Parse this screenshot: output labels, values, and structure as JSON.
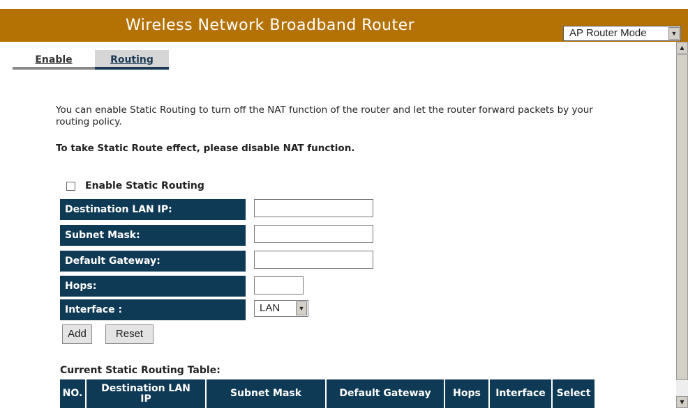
{
  "header": {
    "title": "Wireless Network Broadband Router",
    "mode_select": "AP Router Mode"
  },
  "tabs": [
    {
      "label": "Enable"
    },
    {
      "label": "Routing"
    }
  ],
  "main": {
    "intro": "You can enable Static Routing to turn off the NAT function of the router and let the router forward packets by your routing policy.",
    "warning": "To take Static Route effect, please disable NAT function.",
    "enable_checkbox_label": "Enable Static Routing",
    "enable_checked": false
  },
  "form": {
    "dest_ip_label": "Destination LAN IP:",
    "dest_ip_value": "",
    "subnet_label": "Subnet Mask:",
    "subnet_value": "",
    "gateway_label": "Default Gateway:",
    "gateway_value": "",
    "hops_label": "Hops:",
    "hops_value": "",
    "interface_label": "Interface :",
    "interface_value": "LAN",
    "add_label": "Add",
    "reset_label": "Reset"
  },
  "table": {
    "title": "Current Static Routing Table:",
    "columns": [
      "NO.",
      "Destination LAN IP",
      "Subnet Mask",
      "Default Gateway",
      "Hops",
      "Interface",
      "Select"
    ]
  },
  "colors": {
    "header_bg": "#b57204",
    "label_bg": "#0f3a55"
  }
}
